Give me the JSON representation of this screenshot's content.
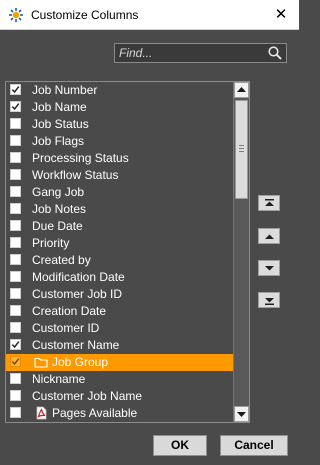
{
  "window": {
    "title": "Customize Columns",
    "close_glyph": "✕"
  },
  "search": {
    "placeholder": "Find...",
    "value": "",
    "icon": "search-icon"
  },
  "list": {
    "items": [
      {
        "label": "Job Number",
        "checked": true,
        "selected": false,
        "icon": null
      },
      {
        "label": "Job Name",
        "checked": true,
        "selected": false,
        "icon": null
      },
      {
        "label": "Job Status",
        "checked": false,
        "selected": false,
        "icon": null
      },
      {
        "label": "Job Flags",
        "checked": false,
        "selected": false,
        "icon": null
      },
      {
        "label": "Processing Status",
        "checked": false,
        "selected": false,
        "icon": null
      },
      {
        "label": "Workflow Status",
        "checked": false,
        "selected": false,
        "icon": null
      },
      {
        "label": "Gang Job",
        "checked": false,
        "selected": false,
        "icon": null
      },
      {
        "label": "Job Notes",
        "checked": false,
        "selected": false,
        "icon": null
      },
      {
        "label": "Due Date",
        "checked": false,
        "selected": false,
        "icon": null
      },
      {
        "label": "Priority",
        "checked": false,
        "selected": false,
        "icon": null
      },
      {
        "label": "Created by",
        "checked": false,
        "selected": false,
        "icon": null
      },
      {
        "label": "Modification Date",
        "checked": false,
        "selected": false,
        "icon": null
      },
      {
        "label": "Customer Job ID",
        "checked": false,
        "selected": false,
        "icon": null
      },
      {
        "label": "Creation Date",
        "checked": false,
        "selected": false,
        "icon": null
      },
      {
        "label": "Customer ID",
        "checked": false,
        "selected": false,
        "icon": null
      },
      {
        "label": "Customer Name",
        "checked": true,
        "selected": false,
        "icon": null
      },
      {
        "label": "Job Group",
        "checked": true,
        "selected": true,
        "icon": "folder-icon"
      },
      {
        "label": "Nickname",
        "checked": false,
        "selected": false,
        "icon": null
      },
      {
        "label": "Customer Job Name",
        "checked": false,
        "selected": false,
        "icon": null
      },
      {
        "label": "Pages Available",
        "checked": false,
        "selected": false,
        "icon": "pdf-document-icon"
      }
    ]
  },
  "move_buttons": [
    {
      "name": "move-to-top-button",
      "icon": "double-up-arrow-icon"
    },
    {
      "name": "move-up-button",
      "icon": "up-arrow-icon"
    },
    {
      "name": "move-down-button",
      "icon": "down-arrow-icon"
    },
    {
      "name": "move-to-bottom-button",
      "icon": "double-down-arrow-icon"
    }
  ],
  "buttons": {
    "ok": "OK",
    "cancel": "Cancel"
  },
  "colors": {
    "background": "#4a4a4a",
    "selection": "#ff9900",
    "text": "#ffffff"
  }
}
